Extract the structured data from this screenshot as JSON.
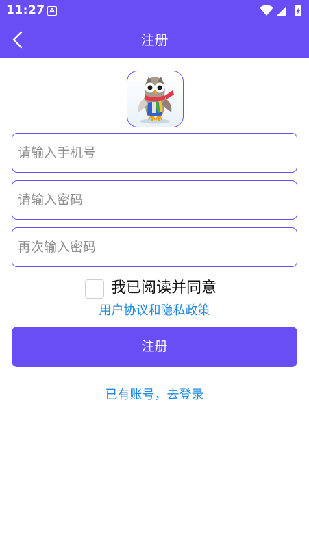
{
  "status_bar": {
    "time": "11:27",
    "notification_icon": "a-notification-icon",
    "icons": [
      "wifi-icon",
      "cellular-signal-icon",
      "battery-charging-icon"
    ]
  },
  "nav": {
    "back_icon": "chevron-left-icon",
    "title": "注册"
  },
  "logo": {
    "icon": "owl-mascot-app-icon"
  },
  "form": {
    "phone_placeholder": "请输入手机号",
    "password_placeholder": "请输入密码",
    "confirm_password_placeholder": "再次输入密码",
    "agreement_checked": false,
    "agreement_label": "我已阅读并同意",
    "policy_link": "用户协议和隐私政策",
    "register_button": "注册",
    "login_link": "已有账号，去登录"
  },
  "colors": {
    "primary": "#6a4ef5",
    "link": "#1e88e5",
    "background": "#ffffff",
    "placeholder": "#8f8f8f"
  }
}
